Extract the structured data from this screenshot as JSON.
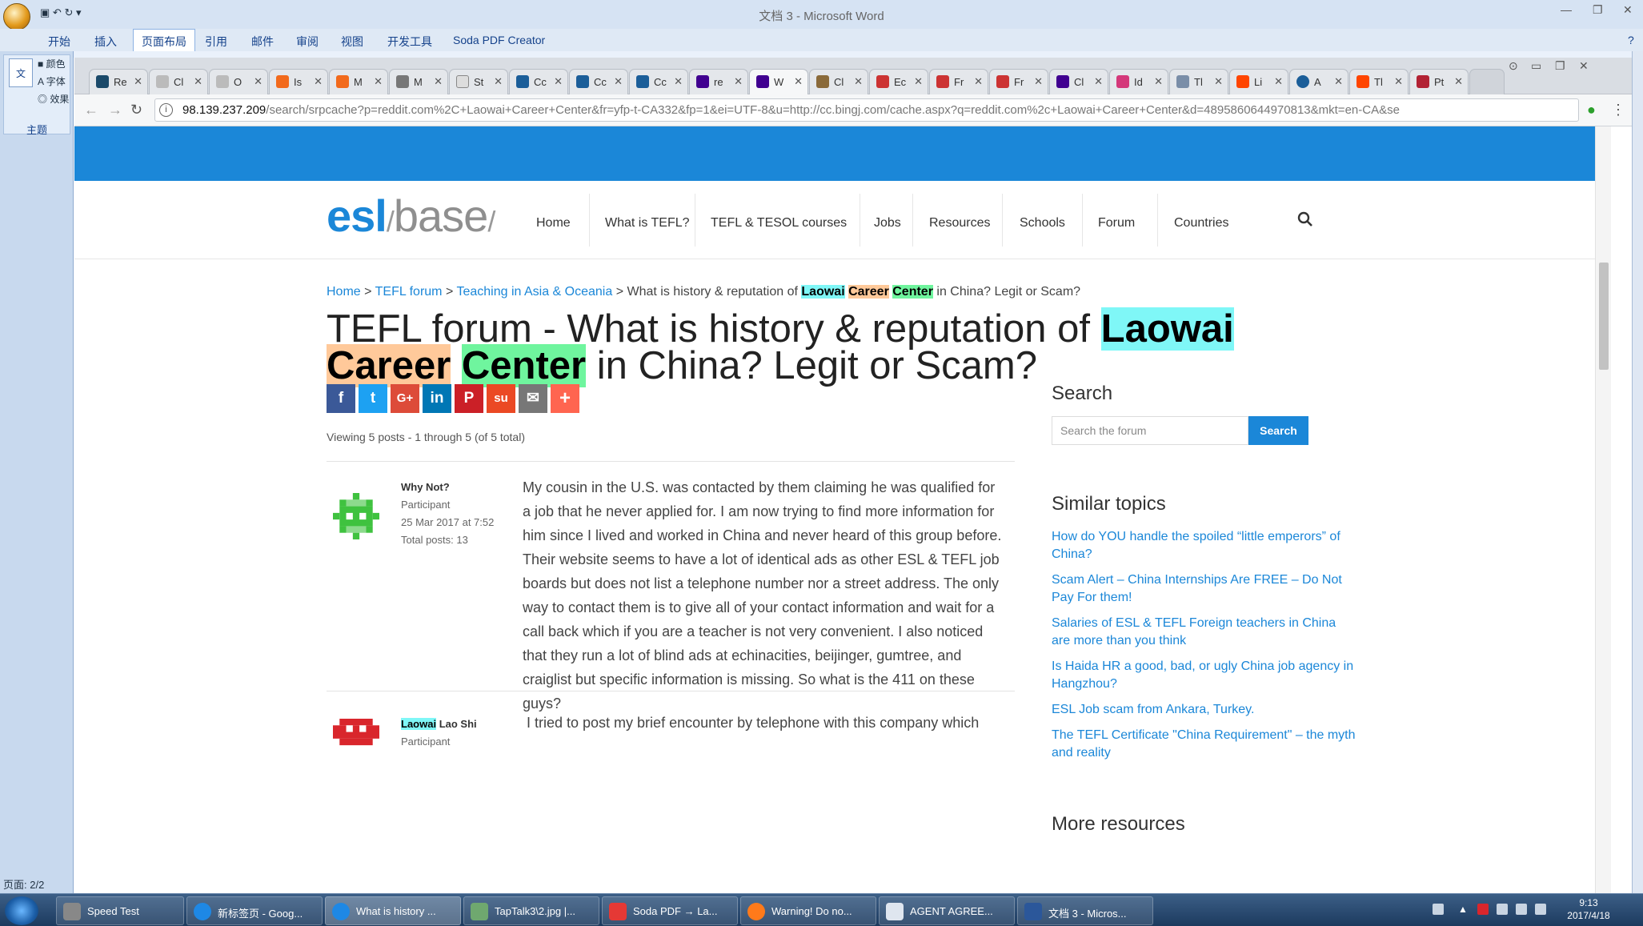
{
  "word": {
    "title": "文档 3 - Microsoft Word",
    "tabs": [
      "开始",
      "插入",
      "页面布局",
      "引用",
      "邮件",
      "审阅",
      "视图",
      "开发工具",
      "Soda PDF Creator"
    ],
    "active_tab": "页面布局",
    "left_label": "主题",
    "left_items": [
      "颜色",
      "字体",
      "效果"
    ],
    "status_page": "页面: 2/2"
  },
  "browser": {
    "tabs": [
      "Re",
      "Cl",
      "O",
      "Is",
      "M",
      "M",
      "St",
      "Cc",
      "Cc",
      "Cc",
      "re",
      "W",
      "Cl",
      "Ec",
      "Fr",
      "Fr",
      "Cl",
      "Id",
      "Tl",
      "Li",
      "A",
      "Tl",
      "Pt"
    ],
    "active_tab_index": 11,
    "url_host": "98.139.237.209",
    "url_path": "/search/srpcache?p=reddit.com%2C+Laowai+Career+Center&fr=yfp-t-CA332&fp=1&ei=UTF-8&u=http://cc.bingj.com/cache.aspx?q=reddit.com%2c+Laowai+Career+Center&d=4895860644970813&mkt=en-CA&se"
  },
  "site": {
    "logo_main": "esl",
    "logo_slash": "/",
    "logo_base": "base",
    "menu": [
      "Home",
      "What is TEFL?",
      "TEFL & TESOL courses",
      "Jobs",
      "Resources",
      "Schools",
      "Forum",
      "Countries"
    ],
    "breadcrumb": {
      "home": "Home",
      "sep": ">",
      "forum": "TEFL forum",
      "section": "Teaching in Asia & Oceania",
      "current_prefix": "What is history & reputation of",
      "w1": "Laowai",
      "w2": "Career",
      "w3": "Center",
      "current_suffix": "in China? Legit or Scam?"
    },
    "title": {
      "prefix": "TEFL forum - What is history & reputation of",
      "w1": "Laowai",
      "w2": "Career",
      "w3": "Center",
      "suffix": "in China? Legit or Scam?"
    },
    "share_icons": [
      "f",
      "t",
      "G+",
      "in",
      "P",
      "su",
      "✉",
      "+"
    ],
    "viewing": "Viewing 5 posts - 1 through 5 (of 5 total)",
    "post1": {
      "author": "Why Not?",
      "role": "Participant",
      "date": "25 Mar 2017 at 7:52",
      "posts": "Total posts: 13",
      "body": "My cousin in the U.S. was contacted by them claiming he was qualified for a job that he never applied for. I am now trying to find more information for him since I lived and worked in China and never heard of this group before. Their website seems to have a lot of identical ads as other ESL & TEFL job boards but does not list a telephone number nor a street address. The only way to contact them is to give all of your contact information and wait for a call back which if you are a teacher is not very convenient. I also noticed that they run a lot of blind ads at echinacities, beijinger, gumtree, and craiglist but specific information is missing. So what is the 411 on these guys?"
    },
    "post2": {
      "author_hl": "Laowai",
      "author_rest": "Lao Shi",
      "role": "Participant",
      "body": "I tried to post my brief encounter by telephone with this company which"
    },
    "sidebar": {
      "search_title": "Search",
      "search_placeholder": "Search the forum",
      "search_button": "Search",
      "similar_title": "Similar topics",
      "topics": [
        "How do YOU handle the spoiled “little emperors” of China?",
        "Scam Alert – China Internships Are FREE – Do Not Pay For them!",
        "Salaries of ESL & TEFL Foreign teachers in China are more than you think",
        "Is Haida HR a good, bad, or ugly China job agency in Hangzhou?",
        "ESL Job scam from Ankara, Turkey.",
        "The TEFL Certificate \"China Requirement\" – the myth and reality"
      ],
      "more_title": "More resources"
    }
  },
  "taskbar": {
    "items": [
      "Speed Test",
      "新标签页 - Goog...",
      "What is history ...",
      "TapTalk3\\2.jpg |...",
      "Soda PDF → La...",
      "Warning! Do no...",
      "AGENT AGREE...",
      "文档 3 - Micros..."
    ],
    "time": "9:13",
    "date": "2017/4/18"
  }
}
